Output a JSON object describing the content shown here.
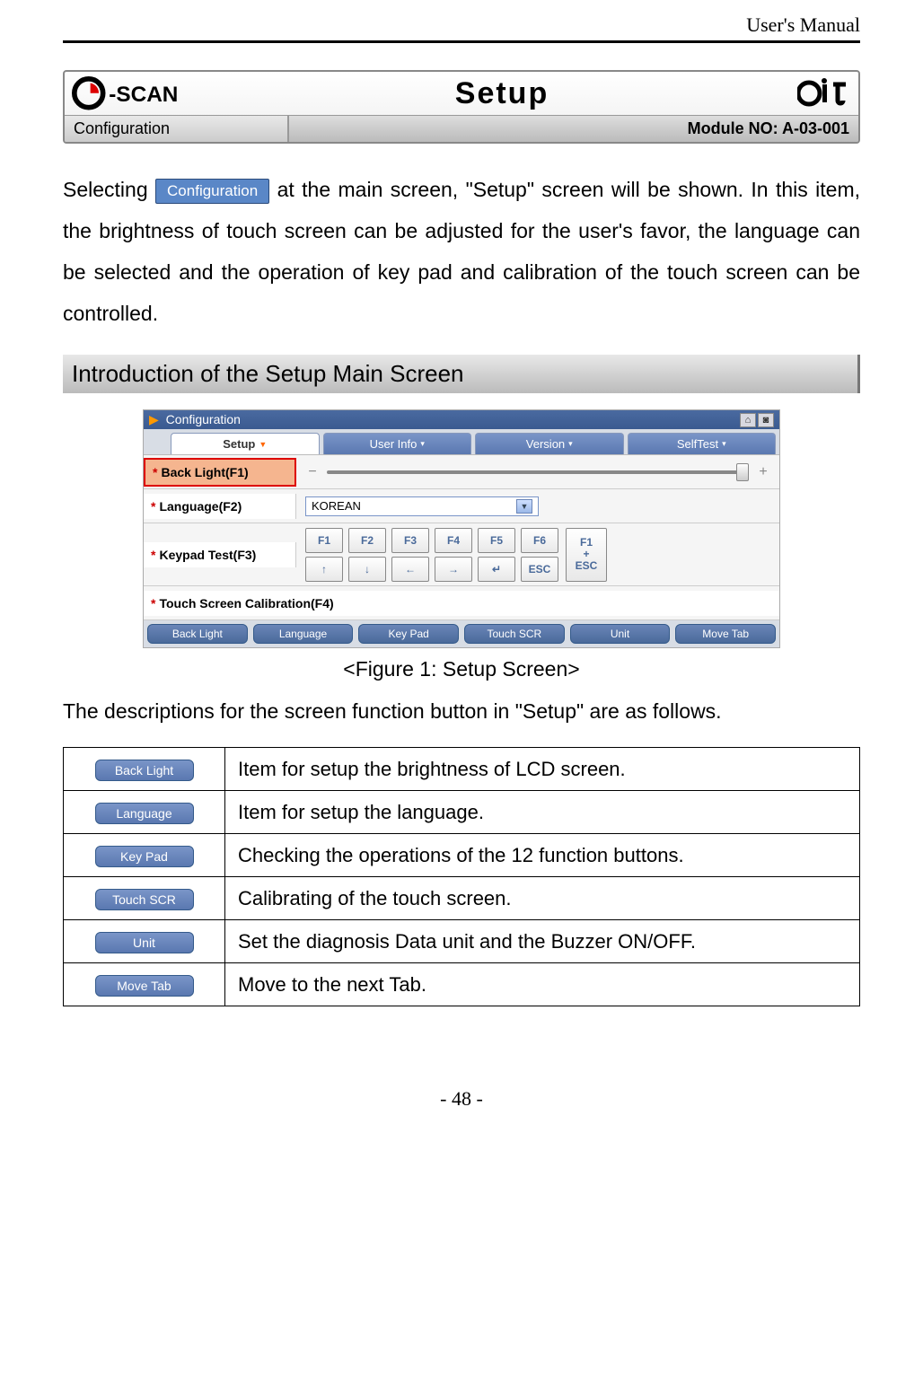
{
  "doc_header": "User's Manual",
  "page_title": "Setup",
  "subheader_left": "Configuration",
  "subheader_right": "Module NO: A-03-001",
  "intro": {
    "lead": "Selecting",
    "config_badge": "Configuration",
    "rest": "at the main screen, \"Setup\" screen will be shown. In this item, the brightness of touch screen can be adjusted for the user's favor, the language can be selected and the operation of key pad and calibration of the touch screen can be controlled."
  },
  "section_heading": "Introduction of the Setup Main Screen",
  "screenshot": {
    "topbar_label": "Configuration",
    "tabs": [
      "Setup",
      "User Info",
      "Version",
      "SelfTest"
    ],
    "rows": {
      "backlight_label": "Back Light(F1)",
      "language_label": "Language(F2)",
      "language_value": "KOREAN",
      "keypad_label": "Keypad Test(F3)",
      "keypad_keys_row1": [
        "F1",
        "F2",
        "F3",
        "F4",
        "F5",
        "F6"
      ],
      "keypad_keys_row2": [
        "↑",
        "↓",
        "←",
        "→",
        "↵",
        "ESC"
      ],
      "keypad_combo_top": "F1",
      "keypad_combo_mid": "+",
      "keypad_combo_bot": "ESC",
      "calibration_label": "Touch Screen Calibration(F4)"
    },
    "footer_buttons": [
      "Back Light",
      "Language",
      "Key Pad",
      "Touch SCR",
      "Unit",
      "Move Tab"
    ]
  },
  "figure_caption": "<Figure 1: Setup Screen>",
  "followup_text": "The descriptions for the screen function button in \"Setup\" are as follows.",
  "desc_table": [
    {
      "button": "Back Light",
      "desc": "Item for setup the brightness of LCD screen."
    },
    {
      "button": "Language",
      "desc": "Item for setup the language."
    },
    {
      "button": "Key Pad",
      "desc": "Checking the operations of the 12 function buttons."
    },
    {
      "button": "Touch SCR",
      "desc": "Calibrating of the touch screen."
    },
    {
      "button": "Unit",
      "desc": "Set the diagnosis Data unit and the Buzzer ON/OFF."
    },
    {
      "button": "Move Tab",
      "desc": "Move to the next Tab."
    }
  ],
  "page_number": "- 48 -"
}
